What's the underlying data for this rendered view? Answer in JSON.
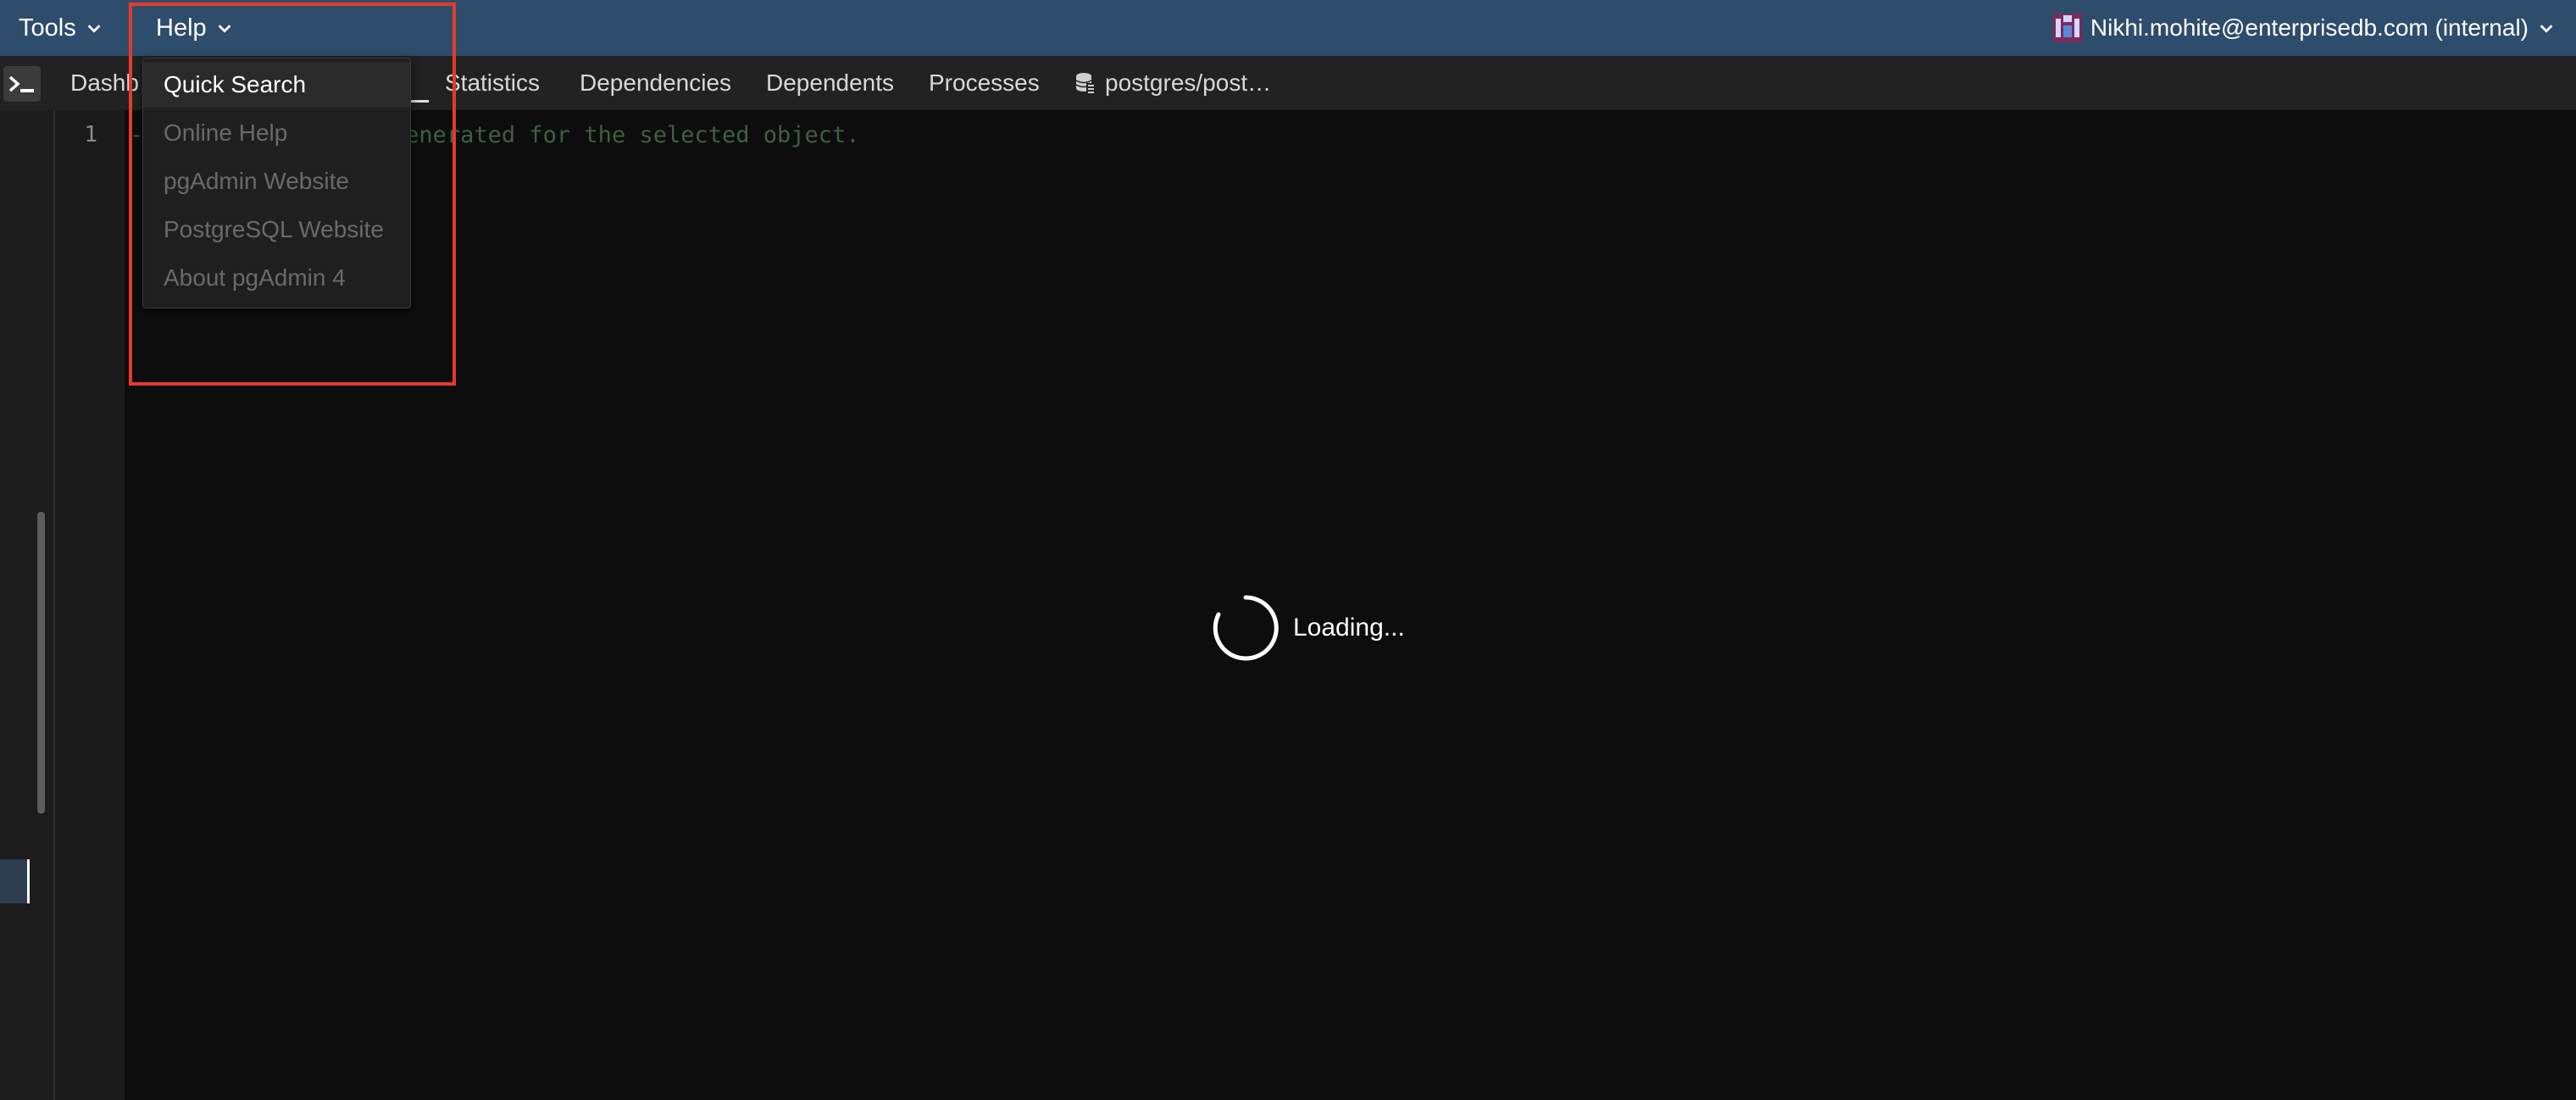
{
  "menubar": {
    "tools_label": "Tools",
    "help_label": "Help",
    "user_label": "Nikhi.mohite@enterprisedb.com (internal)"
  },
  "tabs": [
    {
      "label": "Dashb"
    },
    {
      "label": "Statistics"
    },
    {
      "label": "Dependencies"
    },
    {
      "label": "Dependents"
    },
    {
      "label": "Processes"
    },
    {
      "label": "postgres/post…"
    }
  ],
  "editor": {
    "line_number": "1",
    "code_text": "-- No SQL could be generated for the selected object."
  },
  "loading_text": "Loading...",
  "help_menu": {
    "items": [
      {
        "label": "Quick Search"
      },
      {
        "label": "Online Help"
      },
      {
        "label": "pgAdmin Website"
      },
      {
        "label": "PostgreSQL Website"
      },
      {
        "label": "About pgAdmin 4"
      }
    ]
  },
  "colors": {
    "menubar_bg": "#2e4c6c",
    "annotation": "#e53a2b",
    "editor_bg": "#0d0d0d"
  }
}
